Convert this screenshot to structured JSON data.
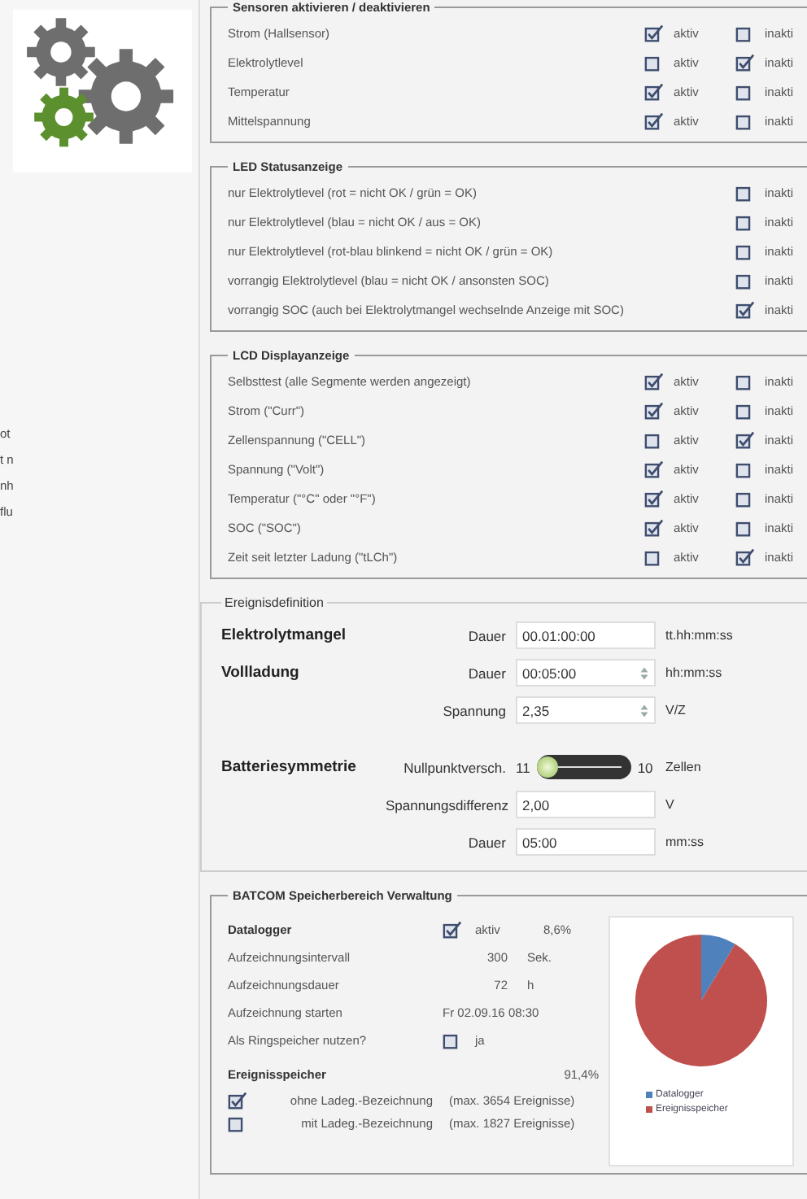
{
  "side_texts": [
    "ot",
    "t n",
    "nh",
    "flu"
  ],
  "sensors": {
    "title": "Sensoren aktivieren / deaktivieren",
    "rows": [
      {
        "label": "Strom (Hallsensor)",
        "active": {
          "label": "aktiv",
          "checked": true
        },
        "inactive": {
          "label": "inakti",
          "checked": false
        }
      },
      {
        "label": "Elektrolytlevel",
        "active": {
          "label": "aktiv",
          "checked": false
        },
        "inactive": {
          "label": "inakti",
          "checked": true
        }
      },
      {
        "label": "Temperatur",
        "active": {
          "label": "aktiv",
          "checked": true
        },
        "inactive": {
          "label": "inakti",
          "checked": false
        }
      },
      {
        "label": "Mittelspannung",
        "active": {
          "label": "aktiv",
          "checked": true
        },
        "inactive": {
          "label": "inakti",
          "checked": false
        }
      }
    ]
  },
  "led": {
    "title": "LED Statusanzeige",
    "rows": [
      {
        "label": "nur Elektrolytlevel (rot = nicht OK / grün = OK)",
        "inactive": {
          "label": "inakti",
          "checked": false
        }
      },
      {
        "label": "nur Elektrolytlevel (blau = nicht OK / aus = OK)",
        "inactive": {
          "label": "inakti",
          "checked": false
        }
      },
      {
        "label": "nur Elektrolytlevel (rot-blau blinkend = nicht OK / grün = OK)",
        "inactive": {
          "label": "inakti",
          "checked": false
        }
      },
      {
        "label": "vorrangig Elektrolytlevel (blau = nicht OK / ansonsten SOC)",
        "inactive": {
          "label": "inakti",
          "checked": false
        }
      },
      {
        "label": "vorrangig SOC (auch bei Elektrolytmangel wechselnde Anzeige mit SOC)",
        "inactive": {
          "label": "inakti",
          "checked": true
        }
      }
    ]
  },
  "lcd": {
    "title": "LCD Displayanzeige",
    "rows": [
      {
        "label": "Selbsttest (alle Segmente werden angezeigt)",
        "active": {
          "label": "aktiv",
          "checked": true
        },
        "inactive": {
          "label": "inakti",
          "checked": false
        }
      },
      {
        "label": "Strom (\"Curr\")",
        "active": {
          "label": "aktiv",
          "checked": true
        },
        "inactive": {
          "label": "inakti",
          "checked": false
        }
      },
      {
        "label": "Zellenspannung (\"CELL\")",
        "active": {
          "label": "aktiv",
          "checked": false
        },
        "inactive": {
          "label": "inakti",
          "checked": true
        }
      },
      {
        "label": "Spannung (\"Volt\")",
        "active": {
          "label": "aktiv",
          "checked": true
        },
        "inactive": {
          "label": "inakti",
          "checked": false
        }
      },
      {
        "label": "Temperatur (\"°C\" oder \"°F\")",
        "active": {
          "label": "aktiv",
          "checked": true
        },
        "inactive": {
          "label": "inakti",
          "checked": false
        }
      },
      {
        "label": "SOC (\"SOC\")",
        "active": {
          "label": "aktiv",
          "checked": true
        },
        "inactive": {
          "label": "inakti",
          "checked": false
        }
      },
      {
        "label": "Zeit seit letzter Ladung (\"tLCh\")",
        "active": {
          "label": "aktiv",
          "checked": false
        },
        "inactive": {
          "label": "inakti",
          "checked": true
        }
      }
    ]
  },
  "events": {
    "title": "Ereignisdefinition",
    "rows": [
      {
        "kind": "field",
        "heading": "Elektrolytmangel",
        "label": "Dauer",
        "value": "00.01:00:00",
        "spinner": false,
        "unit": "tt.hh:mm:ss"
      },
      {
        "kind": "field",
        "heading": "Vollladung",
        "label": "Dauer",
        "value": "00:05:00",
        "spinner": true,
        "unit": "hh:mm:ss"
      },
      {
        "kind": "field",
        "label": "Spannung",
        "value": "2,35",
        "spinner": true,
        "unit": "V/Z"
      },
      {
        "kind": "slider",
        "heading": "Batteriesymmetrie",
        "label": "Nullpunktversch.",
        "min_label": "11",
        "level": 0,
        "max_label": "10",
        "unit": "Zellen"
      },
      {
        "kind": "field",
        "label": "Spannungsdifferenz",
        "value": "2,00",
        "spinner": false,
        "unit": "V"
      },
      {
        "kind": "field",
        "label": "Dauer",
        "value": "05:00",
        "spinner": false,
        "unit": "mm:ss"
      }
    ]
  },
  "batcom": {
    "title": "BATCOM Speicherbereich Verwaltung",
    "datalogger": {
      "label": "Datalogger",
      "checkbox_label": "aktiv",
      "checked": true,
      "percent": "8,6%"
    },
    "settings": [
      {
        "label": "Aufzeichnungsintervall",
        "value": "300",
        "unit": "Sek."
      },
      {
        "label": "Aufzeichnungsdauer",
        "value": "72",
        "unit": "h"
      },
      {
        "label": "Aufzeichnung starten",
        "value": "Fr 02.09.16 08:30"
      }
    ],
    "ring": {
      "label": "Als Ringspeicher nutzen?",
      "checkbox_label": "ja",
      "checked": false
    },
    "event_store": {
      "label": "Ereignisspeicher",
      "percent": "91,4%",
      "options": [
        {
          "label": "ohne Ladeg.-Bezeichnung",
          "note": "(max. 3654 Ereignisse)",
          "checked": true
        },
        {
          "label": "mit Ladeg.-Bezeichnung",
          "note": "(max. 1827 Ereignisse)",
          "checked": false
        }
      ]
    },
    "chart_data": {
      "type": "pie",
      "categories": [
        "Datalogger",
        "Ereignisspeicher"
      ],
      "values": [
        8.6,
        91.4
      ],
      "colors": [
        "#4f81bd",
        "#c0504d"
      ],
      "legend": true
    }
  }
}
